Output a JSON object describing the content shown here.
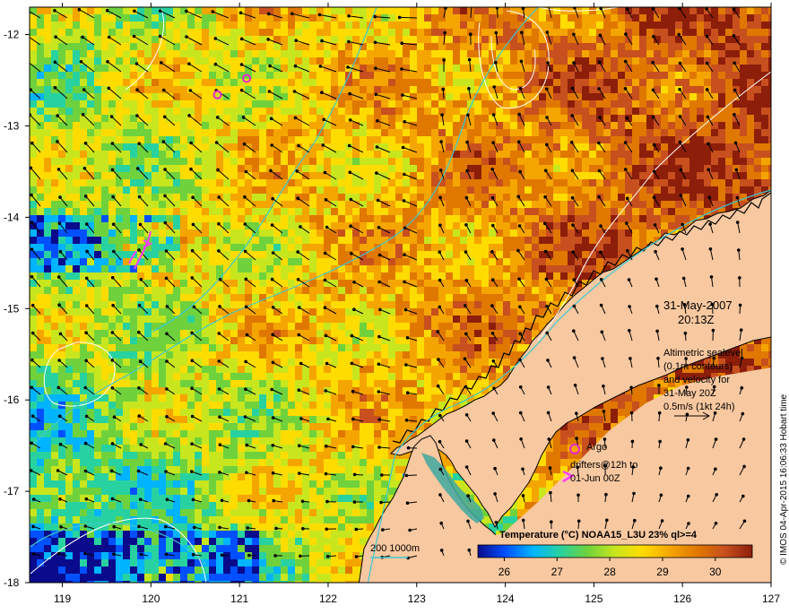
{
  "map": {
    "x_ticks": [
      "119",
      "120",
      "121",
      "122",
      "123",
      "124",
      "125",
      "126",
      "127"
    ],
    "y_ticks": [
      "-12",
      "-13",
      "-14",
      "-15",
      "-16",
      "-17",
      "-18"
    ],
    "lon_range": [
      118.63,
      127.0
    ],
    "lat_range": [
      -18.0,
      -11.7
    ]
  },
  "annotations": {
    "date_line1": "31-May-2007",
    "date_line2": "20:13Z",
    "altimetry_line1": "Altimetric sealevel",
    "altimetry_line2": "(0.1m contours)",
    "altimetry_line3": "and velocity for",
    "altimetry_line4": "31-May 20Z",
    "velocity_scale": "0.5m/s (1kt 24h)",
    "argo_label": "Argo",
    "drifters_line1": "drifters@12h to",
    "drifters_line2": "01-Jun 00Z",
    "depth_label": "200  1000m",
    "credit": "© IMOS 04-Apr-2015 16:06:33 Hobart time"
  },
  "colorbar": {
    "title": "Temperature (°C) NOAA15_L3U 23% ql>=4",
    "labels": [
      "26",
      "27",
      "28",
      "29",
      "30"
    ],
    "range": [
      25.5,
      30.7
    ],
    "colors": [
      "#0a0a8c",
      "#0050ff",
      "#00b4ff",
      "#28d2a0",
      "#6fd23c",
      "#c8e61e",
      "#ffdc00",
      "#f5a500",
      "#e07800",
      "#c8501e",
      "#8c1e0a"
    ]
  },
  "colors": {
    "land": "#f8c8a0",
    "contour": "#ffffff",
    "isobath": "#3cc8d2",
    "argo": "#e628d2",
    "drifter": "#ff3cff"
  },
  "argo_floats": [
    {
      "lon": 121.08,
      "lat": -12.48
    },
    {
      "lon": 120.75,
      "lat": -12.66
    }
  ]
}
